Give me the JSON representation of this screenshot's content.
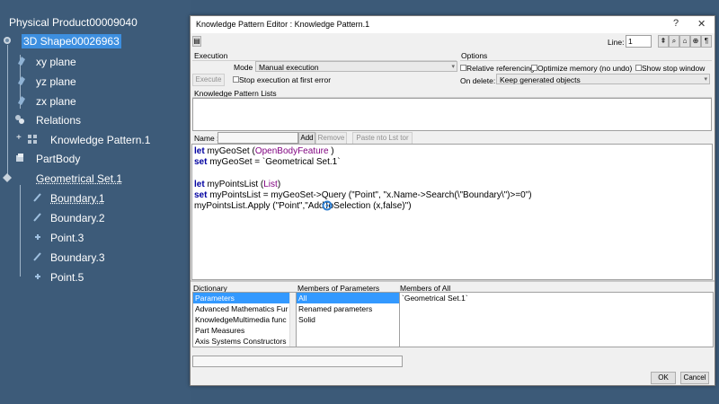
{
  "tree": {
    "root": "Physical Product00009040",
    "shape": "3D Shape00026963",
    "xy": "xy plane",
    "yz": "yz plane",
    "zx": "zx plane",
    "relations": "Relations",
    "kp": "Knowledge Pattern.1",
    "partbody": "PartBody",
    "geoset": "Geometrical Set.1",
    "b1": "Boundary.1",
    "b2": "Boundary.2",
    "p3": "Point.3",
    "b3": "Boundary.3",
    "p5": "Point.5"
  },
  "dialog": {
    "title": "Knowledge Pattern Editor : Knowledge Pattern.1",
    "help": "?",
    "close": "✕",
    "line_label": "Line:",
    "line_value": "1",
    "execution_label": "Execution",
    "mode_label": "Mode",
    "mode_value": "Manual execution",
    "execute_btn": "Execute",
    "stop_first_error": "Stop execution at first error",
    "options_label": "Options",
    "relative_ref": "Relative referencing",
    "optimize_mem": "Optimize memory (no undo)",
    "show_stop": "Show stop window",
    "on_delete_label": "On delete:",
    "on_delete_value": "Keep generated objects",
    "kp_lists_label": "Knowledge Pattern Lists",
    "name_label": "Name :",
    "add_btn": "Add",
    "remove_btn": "Remove",
    "paste_btn": "Paste  nto Lst tor",
    "dictionary_label": "Dictionary",
    "members_params_label": "Members of Parameters",
    "members_all_label": "Members of All",
    "dictionary_items": [
      "Parameters",
      "Advanced Mathematics Fur",
      "KnowledgeMultimedia func",
      "Part Measures",
      "Axis Systems Constructors"
    ],
    "param_members": [
      "All",
      "Renamed parameters",
      "Solid"
    ],
    "all_members": [
      "`Geometrical Set.1`"
    ],
    "ok_btn": "OK",
    "cancel_btn": "Cancel"
  },
  "code": {
    "l1_kw": "let",
    "l1_var": " myGeoSet (",
    "l1_type": "OpenBodyFeature",
    "l1_end": " )",
    "l2_kw": "set",
    "l2_rest": " myGeoSet = `Geometrical Set.1`",
    "l4_kw": "let",
    "l4_var": " myPointsList (",
    "l4_type": "List",
    "l4_end": ")",
    "l5_kw": "set",
    "l5_rest": " myPointsList = myGeoSet->Query (\"Point\", \"x.Name->Search(\\\"Boundary\\\")>=0\")",
    "l6_rest": "myPointsList.Apply (\"Point\",\"AddToSelection (x,false)\")"
  },
  "colors": {
    "tree_bg": "#3d5b79",
    "selection": "#3d8fe0",
    "keyword": "#0000a0",
    "type": "#7f007f"
  }
}
